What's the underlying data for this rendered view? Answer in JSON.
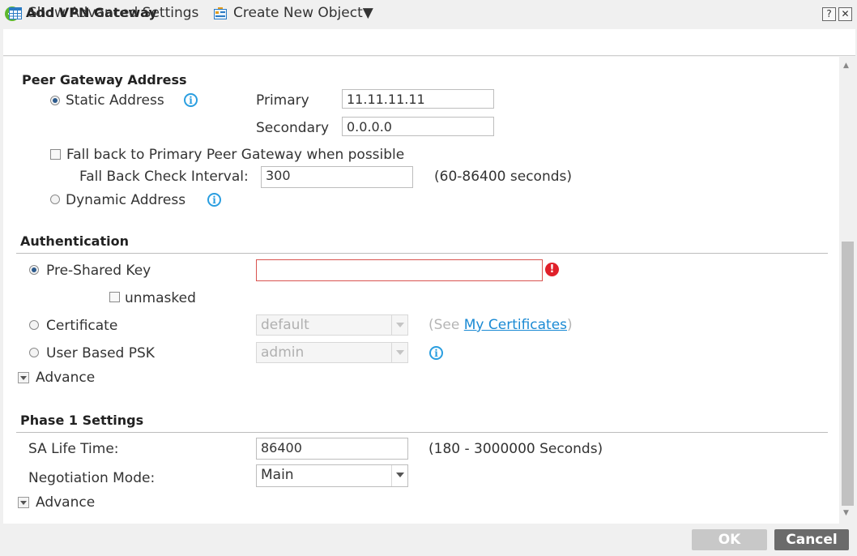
{
  "window": {
    "title": "Add VPN Gateway",
    "help_label": "?",
    "close_label": "✕"
  },
  "toolbar": {
    "show_advanced": "Show Advanced Settings",
    "create_new_object": "Create New Object▼"
  },
  "peer_gateway": {
    "section_title": "Peer Gateway Address",
    "static_label": "Static Address",
    "primary_label": "Primary",
    "primary_value": "11.11.11.11",
    "secondary_label": "Secondary",
    "secondary_value": "0.0.0.0",
    "fallback_label": "Fall back to Primary Peer Gateway when possible",
    "interval_label": "Fall Back Check Interval:",
    "interval_value": "300",
    "interval_hint": "(60-86400 seconds)",
    "dynamic_label": "Dynamic Address",
    "static_selected": true
  },
  "authentication": {
    "section_title": "Authentication",
    "psk_label": "Pre-Shared Key",
    "psk_value": "",
    "unmasked_label": "unmasked",
    "certificate_label": "Certificate",
    "certificate_value": "default",
    "see_prefix": "(See ",
    "see_link": "My Certificates",
    "see_suffix": ")",
    "user_psk_label": "User Based PSK",
    "user_psk_value": "admin",
    "advance_label": "Advance"
  },
  "phase1": {
    "section_title": "Phase 1 Settings",
    "sa_label": "SA Life Time:",
    "sa_value": "86400",
    "sa_hint": "(180 - 3000000 Seconds)",
    "mode_label": "Negotiation Mode:",
    "mode_value": "Main",
    "advance_label": "Advance"
  },
  "footer": {
    "ok_label": "OK",
    "cancel_label": "Cancel"
  },
  "colors": {
    "accent_blue": "#2a9ee0",
    "error_red": "#e0202a",
    "ok_disabled": "#c8c8c8",
    "cancel": "#6b6b6b"
  }
}
